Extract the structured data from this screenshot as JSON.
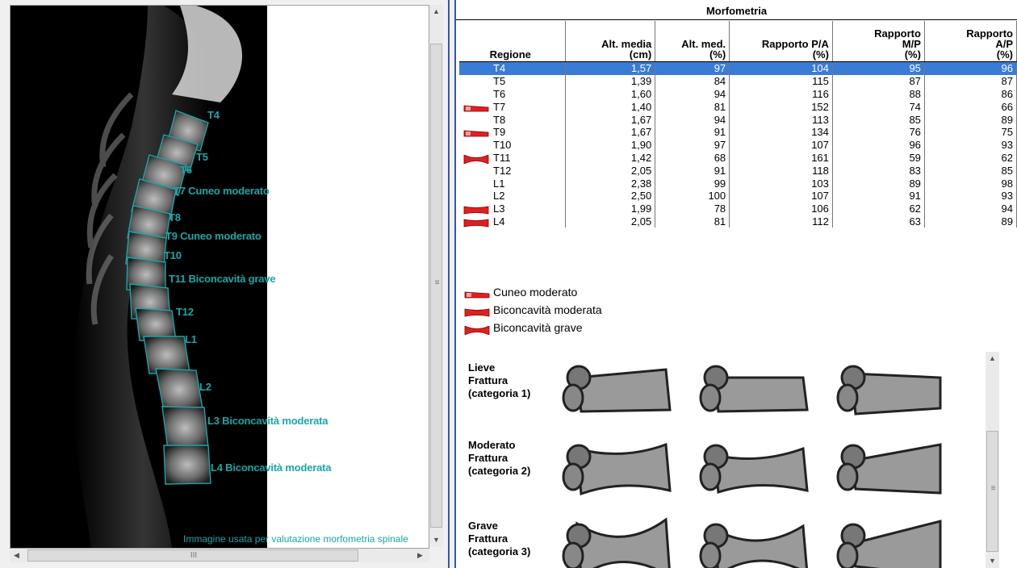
{
  "xray": {
    "labels": [
      {
        "text": "T4"
      },
      {
        "text": "T5"
      },
      {
        "text": "T6"
      },
      {
        "text": "T7 Cuneo moderato"
      },
      {
        "text": "T8"
      },
      {
        "text": "T9 Cuneo moderato"
      },
      {
        "text": "T10"
      },
      {
        "text": "T11 Biconcavità grave"
      },
      {
        "text": "T12"
      },
      {
        "text": "L1"
      },
      {
        "text": "L2"
      },
      {
        "text": "L3 Biconcavità moderata"
      },
      {
        "text": "L4 Biconcavità moderata"
      }
    ],
    "caption": "Immagine usata per valutazione morfometria spinale"
  },
  "scrollbar": {
    "h_thumb_glyph": "III",
    "v_thumb_glyph": "≡"
  },
  "morfometria": {
    "title": "Morfometria",
    "headers": [
      "Regione",
      "Alt. media (cm)",
      "Alt. med. (%)",
      "Rapporto P/A (%)",
      "Rapporto M/P (%)",
      "Rapporto A/P (%)"
    ],
    "header_lines": [
      [
        "Regione"
      ],
      [
        "Alt. media",
        "(cm)"
      ],
      [
        "Alt. med.",
        "(%)"
      ],
      [
        "Rapporto P/A",
        "(%)"
      ],
      [
        "Rapporto",
        "M/P",
        "(%)"
      ],
      [
        "Rapporto",
        "A/P",
        "(%)"
      ]
    ],
    "rows": [
      {
        "region": "T4",
        "alt_media": "1,57",
        "alt_med": "97",
        "pa": "104",
        "mp": "95",
        "ap": "96",
        "icon": "",
        "selected": true
      },
      {
        "region": "T5",
        "alt_media": "1,39",
        "alt_med": "84",
        "pa": "115",
        "mp": "87",
        "ap": "87",
        "icon": ""
      },
      {
        "region": "T6",
        "alt_media": "1,60",
        "alt_med": "94",
        "pa": "116",
        "mp": "88",
        "ap": "86",
        "icon": ""
      },
      {
        "region": "T7",
        "alt_media": "1,40",
        "alt_med": "81",
        "pa": "152",
        "mp": "74",
        "ap": "66",
        "icon": "wedge-moderate-icon"
      },
      {
        "region": "T8",
        "alt_media": "1,67",
        "alt_med": "94",
        "pa": "113",
        "mp": "85",
        "ap": "89",
        "icon": ""
      },
      {
        "region": "T9",
        "alt_media": "1,67",
        "alt_med": "91",
        "pa": "134",
        "mp": "76",
        "ap": "75",
        "icon": "wedge-moderate-icon"
      },
      {
        "region": "T10",
        "alt_media": "1,90",
        "alt_med": "97",
        "pa": "107",
        "mp": "96",
        "ap": "93",
        "icon": ""
      },
      {
        "region": "T11",
        "alt_media": "1,42",
        "alt_med": "68",
        "pa": "161",
        "mp": "59",
        "ap": "62",
        "icon": "biconcave-severe-icon"
      },
      {
        "region": "T12",
        "alt_media": "2,05",
        "alt_med": "91",
        "pa": "118",
        "mp": "83",
        "ap": "85",
        "icon": ""
      },
      {
        "region": "L1",
        "alt_media": "2,38",
        "alt_med": "99",
        "pa": "103",
        "mp": "89",
        "ap": "98",
        "icon": ""
      },
      {
        "region": "L2",
        "alt_media": "2,50",
        "alt_med": "100",
        "pa": "107",
        "mp": "91",
        "ap": "93",
        "icon": ""
      },
      {
        "region": "L3",
        "alt_media": "1,99",
        "alt_med": "78",
        "pa": "106",
        "mp": "62",
        "ap": "94",
        "icon": "biconcave-moderate-icon"
      },
      {
        "region": "L4",
        "alt_media": "2,05",
        "alt_med": "81",
        "pa": "112",
        "mp": "63",
        "ap": "89",
        "icon": "biconcave-moderate-icon"
      }
    ]
  },
  "legend": [
    {
      "label": "Cuneo moderato",
      "icon": "wedge-moderate-icon"
    },
    {
      "label": "Biconcavità moderata",
      "icon": "biconcave-moderate-icon"
    },
    {
      "label": "Biconcavità grave",
      "icon": "biconcave-severe-icon"
    }
  ],
  "fracture_categories": [
    {
      "lines": [
        "Lieve",
        "Frattura",
        "(categoria 1)"
      ]
    },
    {
      "lines": [
        "Moderato",
        "Frattura",
        "(categoria 2)"
      ]
    },
    {
      "lines": [
        "Grave",
        "Frattura",
        "(categoria 3)"
      ]
    }
  ],
  "colors": {
    "label_teal": "#1aa6a6",
    "selection": "#3a7bd5",
    "icon_red": "#e02020"
  }
}
